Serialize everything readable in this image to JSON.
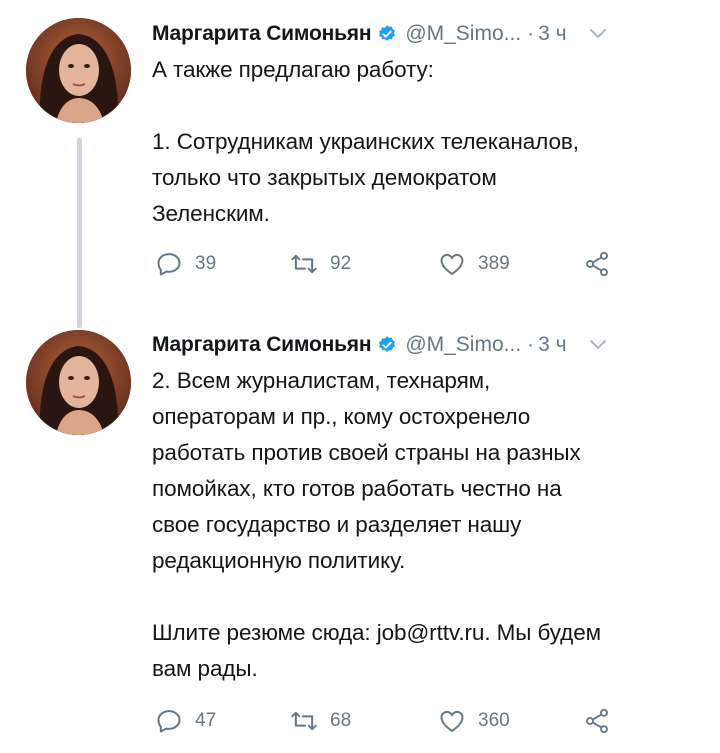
{
  "tweets": [
    {
      "author": "Маргарита Симоньян",
      "handle": "@M_Simo...",
      "time": "3 ч",
      "text": "А также предлагаю работу:\n\n1. Сотрудникам украинских телеканалов,\nтолько что закрытых демократом\nЗеленским.",
      "replies": "39",
      "retweets": "92",
      "likes": "389"
    },
    {
      "author": "Маргарита Симоньян",
      "handle": "@M_Simo...",
      "time": "3 ч",
      "text": "2. Всем журналистам, технарям,\nоператорам и пр., кому остохренело\nработать против своей страны на разных\nпомойках, кто готов работать честно на\nсвое государство и разделяет нашу\nредакционную политику.\n\nШлите резюме сюда: job@rttv.ru. Мы будем\nвам рады.",
      "replies": "47",
      "retweets": "68",
      "likes": "360"
    }
  ],
  "icons": {
    "reply": "reply-icon",
    "retweet": "retweet-icon",
    "like": "heart-icon",
    "share": "share-icon",
    "verified": "verified-badge-icon",
    "caret": "chevron-down-icon"
  },
  "colors": {
    "text": "#14171a",
    "secondary": "#657786",
    "verified": "#1da1f2",
    "thread_line": "#ccd6dd"
  }
}
